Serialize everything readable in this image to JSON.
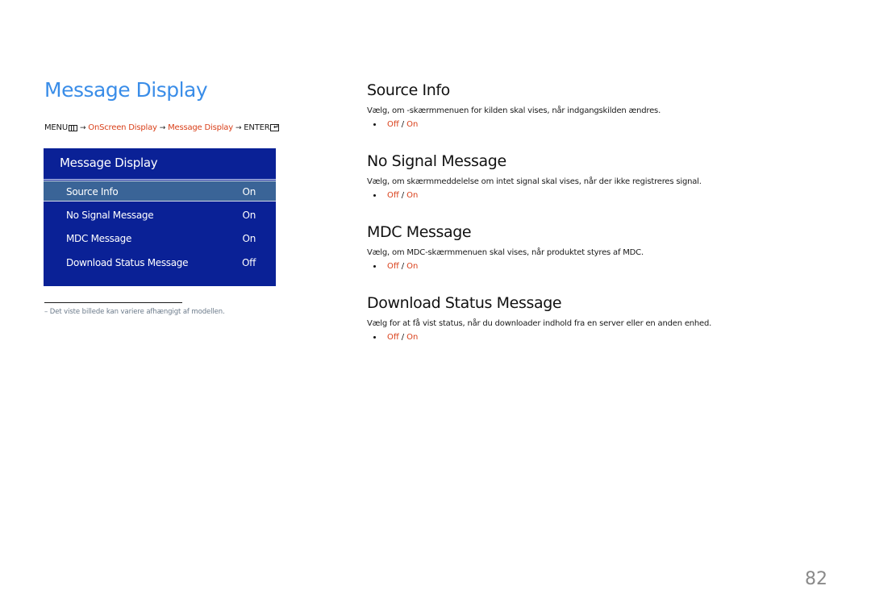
{
  "page": {
    "title": "Message Display",
    "number": "82"
  },
  "breadcrumb": {
    "menu": "MENU",
    "menu_icon": "menu-grid-icon",
    "arrow": "→",
    "step1": "OnScreen Display",
    "step2": "Message Display",
    "enter": "ENTER",
    "enter_icon": "enter-icon"
  },
  "osd": {
    "title": "Message Display",
    "items": [
      {
        "label": "Source Info",
        "value": "On",
        "selected": true
      },
      {
        "label": "No Signal Message",
        "value": "On",
        "selected": false
      },
      {
        "label": "MDC Message",
        "value": "On",
        "selected": false
      },
      {
        "label": "Download Status Message",
        "value": "Off",
        "selected": false
      }
    ]
  },
  "footnote": "–  Det viste billede kan variere afhængigt af modellen.",
  "sections": [
    {
      "heading": "Source Info",
      "description": "Vælg, om -skærmmenuen for kilden skal vises, når indgangskilden ændres.",
      "options": [
        "Off",
        "On"
      ]
    },
    {
      "heading": "No Signal Message",
      "description": "Vælg, om skærmmeddelelse om intet signal skal vises, når der ikke registreres signal.",
      "options": [
        "Off",
        "On"
      ]
    },
    {
      "heading": "MDC Message",
      "description": "Vælg, om MDC-skærmmenuen skal vises, når produktet styres af MDC.",
      "options": [
        "Off",
        "On"
      ]
    },
    {
      "heading": "Download Status Message",
      "description": "Vælg for at få vist status, når du downloader indhold fra en server eller en anden enhed.",
      "options": [
        "Off",
        "On"
      ]
    }
  ],
  "option_separator": "/",
  "colors": {
    "title_blue": "#3a8de8",
    "accent_red": "#d9401a",
    "osd_background": "#0a2196",
    "osd_selected": "#3a6497",
    "page_number_gray": "#8a8a8a"
  }
}
